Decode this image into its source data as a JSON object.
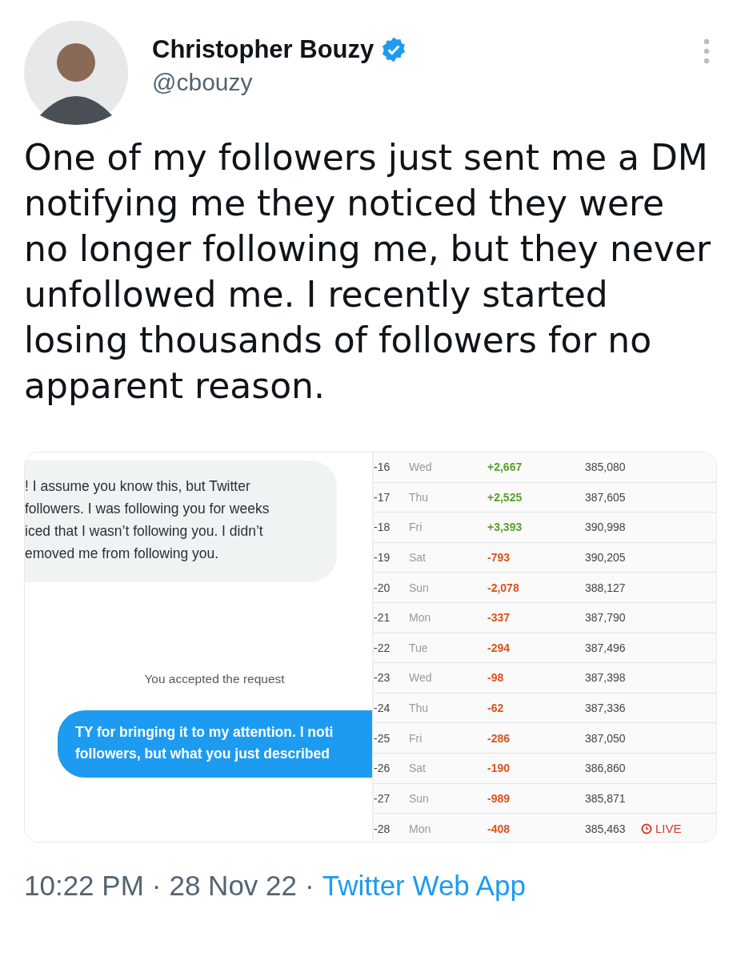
{
  "author": {
    "name": "Christopher Bouzy",
    "handle": "@cbouzy",
    "verified": true
  },
  "text": "One of my followers just sent me a DM notifying me they noticed they were no longer following me, but they never unfollowed me. I recently started losing thousands of followers for no apparent reason.",
  "media": {
    "dm": {
      "incoming": [
        "! I assume you know this, but Twitter",
        "followers. I was following you for weeks",
        "iced that I wasn’t following you. I didn’t",
        "emoved me from following you."
      ],
      "notice": "You accepted the request",
      "outgoing": [
        "TY for bringing it to my attention. I noti",
        "followers, but what you just described"
      ]
    },
    "stats": [
      {
        "date": "-16",
        "day": "Wed",
        "change": "+2,667",
        "color": "#5aa02c",
        "total": "385,080"
      },
      {
        "date": "-17",
        "day": "Thu",
        "change": "+2,525",
        "color": "#5aa02c",
        "total": "387,605"
      },
      {
        "date": "-18",
        "day": "Fri",
        "change": "+3,393",
        "color": "#5aa02c",
        "total": "390,998"
      },
      {
        "date": "-19",
        "day": "Sat",
        "change": "-793",
        "color": "#d9531e",
        "total": "390,205"
      },
      {
        "date": "-20",
        "day": "Sun",
        "change": "-2,078",
        "color": "#d9531e",
        "total": "388,127"
      },
      {
        "date": "-21",
        "day": "Mon",
        "change": "-337",
        "color": "#d9531e",
        "total": "387,790"
      },
      {
        "date": "-22",
        "day": "Tue",
        "change": "-294",
        "color": "#d9531e",
        "total": "387,496"
      },
      {
        "date": "-23",
        "day": "Wed",
        "change": "-98",
        "color": "#d9531e",
        "total": "387,398"
      },
      {
        "date": "-24",
        "day": "Thu",
        "change": "-62",
        "color": "#d9531e",
        "total": "387,336"
      },
      {
        "date": "-25",
        "day": "Fri",
        "change": "-286",
        "color": "#d9531e",
        "total": "387,050"
      },
      {
        "date": "-26",
        "day": "Sat",
        "change": "-190",
        "color": "#d9531e",
        "total": "386,860"
      },
      {
        "date": "-27",
        "day": "Sun",
        "change": "-989",
        "color": "#d9531e",
        "total": "385,871"
      },
      {
        "date": "-28",
        "day": "Mon",
        "change": "-408",
        "color": "#d9531e",
        "total": "385,463",
        "badge": "LIVE"
      }
    ]
  },
  "footer": {
    "time": "10:22 PM",
    "separator_1": "·",
    "date": "28 Nov 22",
    "separator_2": "·",
    "source": "Twitter Web App"
  }
}
